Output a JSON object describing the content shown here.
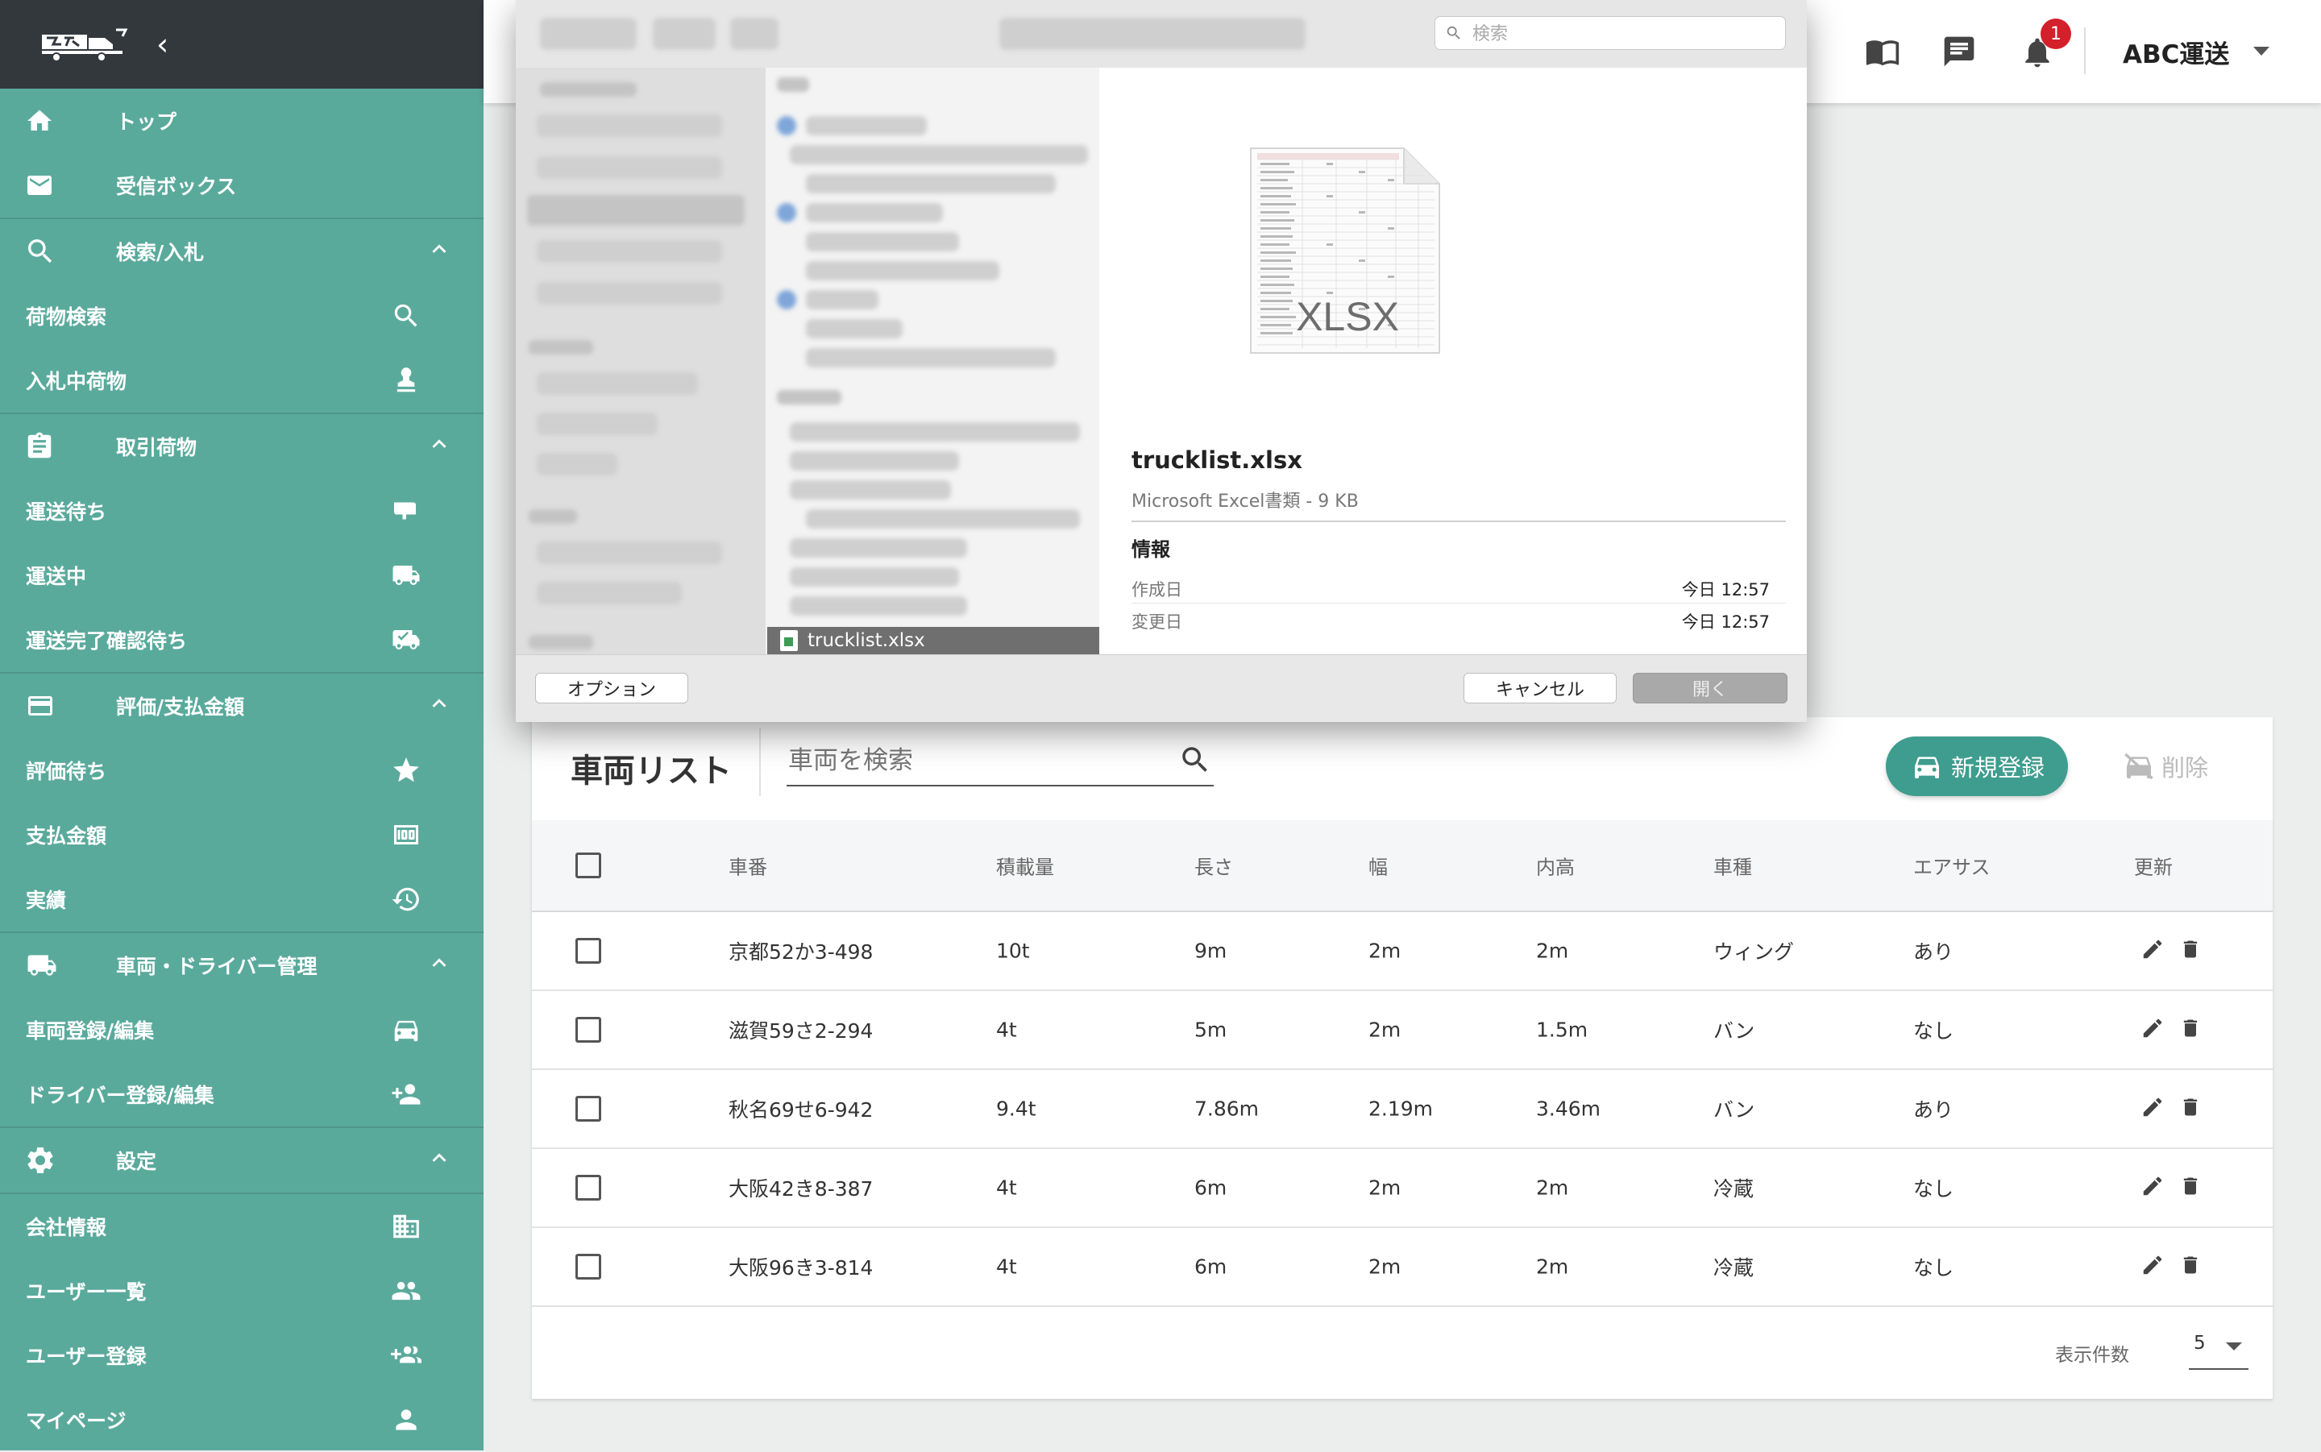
{
  "sidebar": {
    "top": "トップ",
    "inbox": "受信ボックス",
    "sections": {
      "search": "検索/入札",
      "deals": "取引荷物",
      "payment": "評価/支払金額",
      "fleet": "車両・ドライバー管理",
      "settings": "設定"
    },
    "items": {
      "cargo_search": "荷物検索",
      "bidding": "入札中荷物",
      "waiting": "運送待ち",
      "in_transit": "運送中",
      "confirm": "運送完了確認待ち",
      "review_wait": "評価待ち",
      "payment_amount": "支払金額",
      "results": "実績",
      "vehicle_reg": "車両登録/編集",
      "driver_reg": "ドライバー登録/編集",
      "company_info": "会社情報",
      "user_list": "ユーザー一覧",
      "user_reg": "ユーザー登録",
      "mypage": "マイページ"
    }
  },
  "header": {
    "notification_count": "1",
    "company": "ABC運送"
  },
  "dialog": {
    "search_placeholder": "検索",
    "selected_file": "trucklist.xlsx",
    "file_name": "trucklist.xlsx",
    "file_meta": "Microsoft Excel書類 - 9 KB",
    "info_heading": "情報",
    "created_label": "作成日",
    "created_value": "今日 12:57",
    "modified_label": "変更日",
    "modified_value": "今日 12:57",
    "doc_type_label": "XLSX",
    "options_button": "オプション",
    "cancel_button": "キャンセル",
    "open_button": "開く"
  },
  "vehicles": {
    "title": "車両リスト",
    "search_placeholder": "車両を検索",
    "new_button": "新規登録",
    "delete_button": "削除",
    "columns": {
      "number": "車番",
      "capacity": "積載量",
      "length": "長さ",
      "width": "幅",
      "height": "内高",
      "type": "車種",
      "airsus": "エアサス",
      "update": "更新"
    },
    "rows": [
      {
        "number": "京都52か3-498",
        "capacity": "10t",
        "length": "9m",
        "width": "2m",
        "height": "2m",
        "type": "ウィング",
        "airsus": "あり"
      },
      {
        "number": "滋賀59さ2-294",
        "capacity": "4t",
        "length": "5m",
        "width": "2m",
        "height": "1.5m",
        "type": "バン",
        "airsus": "なし"
      },
      {
        "number": "秋名69せ6-942",
        "capacity": "9.4t",
        "length": "7.86m",
        "width": "2.19m",
        "height": "3.46m",
        "type": "バン",
        "airsus": "あり"
      },
      {
        "number": "大阪42き8-387",
        "capacity": "4t",
        "length": "6m",
        "width": "2m",
        "height": "2m",
        "type": "冷蔵",
        "airsus": "なし"
      },
      {
        "number": "大阪96き3-814",
        "capacity": "4t",
        "length": "6m",
        "width": "2m",
        "height": "2m",
        "type": "冷蔵",
        "airsus": "なし"
      }
    ],
    "rows_per_page_label": "表示件数",
    "rows_per_page": "5"
  },
  "colors": {
    "sidebar": "#5aaa9c",
    "sidebar_header": "#33383d",
    "accent": "#3e9d8e",
    "badge": "#d3202a"
  }
}
